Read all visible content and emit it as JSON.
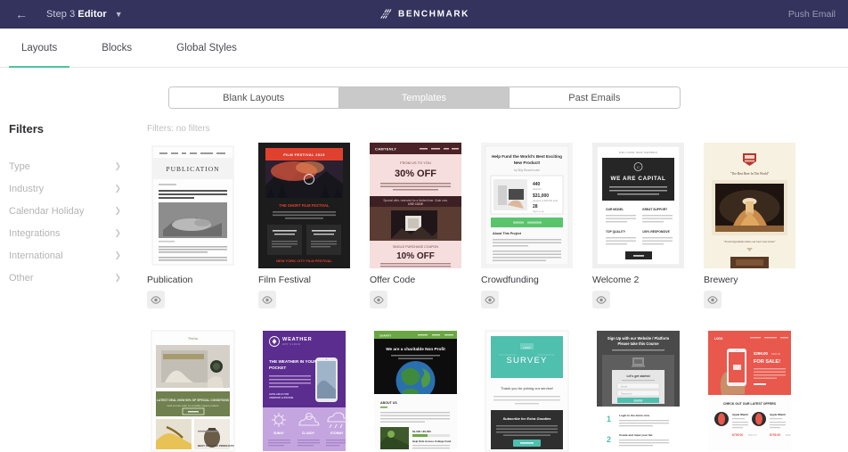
{
  "topbar": {
    "back_icon": "arrow-left-icon",
    "step_prefix": "Step 3",
    "step_name": "Editor",
    "caret_icon": "chevron-down-icon",
    "brand": "BENCHMARK",
    "push_email": "Push Email",
    "bg_color": "#33335e"
  },
  "nav": {
    "tabs": [
      {
        "label": "Layouts",
        "active": true
      },
      {
        "label": "Blocks",
        "active": false
      },
      {
        "label": "Global Styles",
        "active": false
      }
    ],
    "active_underline_color": "#4fc3a1"
  },
  "segmented": {
    "options": [
      {
        "label": "Blank Layouts",
        "active": false
      },
      {
        "label": "Templates",
        "active": true
      },
      {
        "label": "Past Emails",
        "active": false
      }
    ],
    "active_bg": "#c9c9c9"
  },
  "sidebar": {
    "title": "Filters",
    "items": [
      {
        "label": "Type"
      },
      {
        "label": "Industry"
      },
      {
        "label": "Calendar Holiday"
      },
      {
        "label": "Integrations"
      },
      {
        "label": "International"
      },
      {
        "label": "Other"
      }
    ]
  },
  "content": {
    "filters_note": "Filters: no filters",
    "preview_icon": "eye-icon",
    "templates": [
      {
        "label": "Publication",
        "style": "publication"
      },
      {
        "label": "Film Festival",
        "style": "film"
      },
      {
        "label": "Offer Code",
        "style": "offer"
      },
      {
        "label": "Crowdfunding",
        "style": "crowd"
      },
      {
        "label": "Welcome 2",
        "style": "welcome"
      },
      {
        "label": "Brewery",
        "style": "brewery"
      },
      {
        "label": "",
        "style": "spa"
      },
      {
        "label": "",
        "style": "weather"
      },
      {
        "label": "",
        "style": "nonprofit"
      },
      {
        "label": "",
        "style": "survey"
      },
      {
        "label": "",
        "style": "course"
      },
      {
        "label": "",
        "style": "product"
      }
    ]
  },
  "thumb_text": {
    "publication": {
      "title": "PUBLICATION"
    },
    "film": {
      "banner": "FILM FESTIVAL 2019",
      "headline": "THE SHORT FILM FESTIVAL",
      "footer": "NEW YORK CITY FILM FESTIVAL"
    },
    "offer": {
      "brand": "CAMTENLY",
      "kicker": "FROM US TO YOU",
      "deal1": "30% OFF",
      "kicker2": "SINGLE PURCHASE COUPON",
      "deal2": "10% OFF"
    },
    "crowd": {
      "headline": "Help Fund the World's Best Exciting New Product!",
      "stat1": "440",
      "stat1_label": "backers",
      "stat2": "$31,000",
      "stat2_label": "pledged of $40,000 goal",
      "stat3": "28",
      "stat3_label": "days to go",
      "section": "About This Project"
    },
    "welcome": {
      "eyebrow": "WELCOME NEW MEMBER",
      "headline": "WE ARE CAPITAL",
      "c1": "OUR MODEL",
      "c2": "GREAT SUPPORT",
      "c3": "TOP QUALITY",
      "c4": "100% RESPONSIVE"
    },
    "brewery": {
      "tagline": "\"The Best Beer In The World\"",
      "caption": "\"Fresh ingredients make our beer taste better\""
    },
    "weather": {
      "brand": "WEATHER",
      "headline": "THE WEATHER IN YOUR POCKET",
      "i1": "SUNNY",
      "i2": "CLOUDY",
      "i3": "STORMY"
    },
    "nonprofit": {
      "headline": "We are a charitable Non Profit",
      "section": "ABOUT US"
    },
    "survey": {
      "title": "SURVEY",
      "thanks": "Thank you for joining our service!",
      "cta_head": "Subscribe for Extra Goodies"
    },
    "course": {
      "headline": "Sign Up with our Website / Platform Please take this Course",
      "form_title": "Let's get started",
      "step1": "1",
      "step2": "2"
    },
    "product": {
      "price": "$299.00",
      "sale": "FOR SALE!",
      "offers": "CHECK OUT OUR LATEST OFFERS",
      "p1": "$799.00",
      "p2": "$799.00"
    },
    "spa": {
      "banner": "LATEST DEAL NOW 50% OF SPECIAL CONDITIONS",
      "section": "BEST ORGANIC PRODUCTS"
    }
  }
}
